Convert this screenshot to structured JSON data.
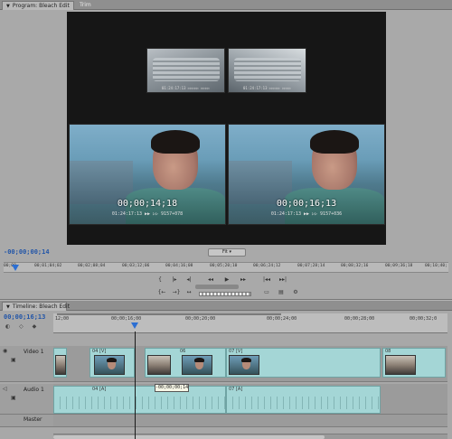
{
  "program_panel": {
    "tab_active": "Program: Bleach Edit",
    "tab_other": "Trim"
  },
  "viewer": {
    "top_left_tc": "01:24:17:13  ▷▷▷▷▷  ▷▷▷▷",
    "top_right_tc": "01:24:17:13  ▷▷▷▷▷  ▷▷▷▷",
    "left_timecode": "00;00;14;18",
    "left_burnin": "01:24:17:13 ▶▶ ▷▷   9157+078",
    "right_timecode": "00;00;16;13",
    "right_burnin": "01:24:17:13 ▶▶ ▷▷   9157+036"
  },
  "info_bar": {
    "current_tc": "-00;00;00;14",
    "zoom_select": "Fit"
  },
  "ruler_ticks": [
    "00;00",
    "00;01;04;02",
    "00;02;08;04",
    "00;03;12;06",
    "00;04;16;08",
    "00;05;20;10",
    "00;06;24;12",
    "00;07;28;14",
    "00;08;32;16",
    "00;09;36;18",
    "00;10;40;"
  ],
  "transport": {
    "row1": [
      "{",
      "|▸",
      "◂|",
      "◂◂",
      "▶",
      "▸▸",
      "|◂◂",
      "▸▸|"
    ],
    "row2": [
      "{←",
      "→}",
      "↔"
    ]
  },
  "timeline": {
    "tab_active": "Timeline: Bleach Edit",
    "current_tc": "00;00;16;13",
    "ruler_ticks": [
      "12;00",
      "00;00;16;00",
      "00;00;20;00",
      "00;00;24;00",
      "00;00;28;00",
      "00;00;32;0"
    ],
    "video_track": "Video 1",
    "audio_track": "Audio 1",
    "master_track": "Master",
    "video_clips": [
      "04 [V]",
      "06",
      "07 [V]",
      "08"
    ],
    "audio_clips": [
      "04 [A]",
      "07 [A]"
    ],
    "tooltip": "-00;00;00;14"
  }
}
